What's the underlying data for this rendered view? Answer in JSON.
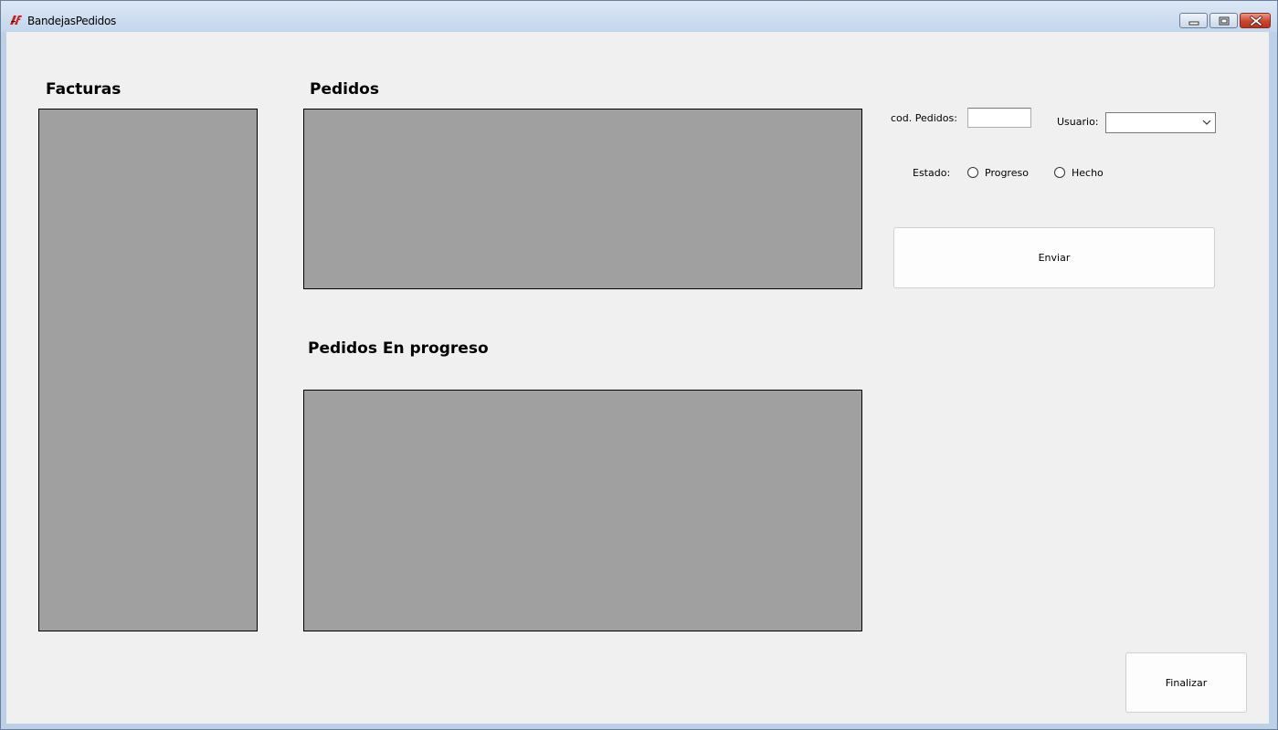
{
  "window": {
    "title": "BandejasPedidos",
    "icon": "app-logo-icon",
    "controls": {
      "minimize": "minimize-icon",
      "maximize": "restore-icon",
      "close": "close-icon"
    }
  },
  "facturas": {
    "heading": "Facturas"
  },
  "pedidos": {
    "heading": "Pedidos"
  },
  "pedidos_progreso": {
    "heading": "Pedidos En progreso"
  },
  "form": {
    "cod_label": "cod. Pedidos:",
    "cod_value": "",
    "usuario_label": "Usuario:",
    "usuario_value": "",
    "estado_label": "Estado:",
    "estado_options": [
      "Progreso",
      "Hecho"
    ],
    "enviar_label": "Enviar"
  },
  "finalizar_label": "Finalizar",
  "colors": {
    "grid_background": "#a0a0a0",
    "form_background": "#f0f0f0",
    "titlebar": "#c3d6ec",
    "close_button": "#c8452f"
  }
}
